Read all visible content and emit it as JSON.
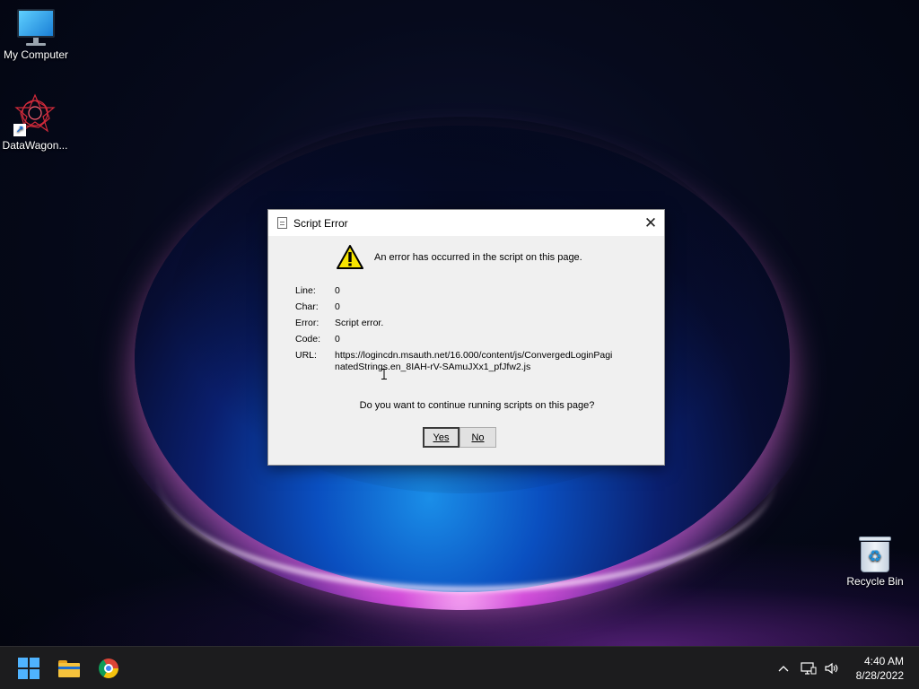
{
  "desktop": {
    "icons": [
      {
        "label": "My Computer",
        "icon": "monitor-icon"
      },
      {
        "label": "DataWagon...",
        "icon": "datawagon-star-icon"
      },
      {
        "label": "Recycle Bin",
        "icon": "recycle-bin-icon"
      }
    ]
  },
  "dialog": {
    "title": "Script Error",
    "close_symbol": "✕",
    "message": "An error has occurred in the script on this page.",
    "fields": [
      {
        "key": "Line:",
        "value": "0"
      },
      {
        "key": "Char:",
        "value": "0"
      },
      {
        "key": "Error:",
        "value": "Script error."
      },
      {
        "key": "Code:",
        "value": "0"
      },
      {
        "key": "URL:",
        "value": "https://logincdn.msauth.net/16.000/content/js/ConvergedLoginPaginatedStrings.en_8IAH-rV-SAmuJXx1_pfJfw2.js"
      }
    ],
    "question": "Do you want to continue running scripts on this page?",
    "buttons": {
      "yes": "Yes",
      "no": "No"
    }
  },
  "taskbar": {
    "apps": [
      {
        "name": "Start",
        "icon": "windows-logo-icon"
      },
      {
        "name": "File Explorer",
        "icon": "folder-icon"
      },
      {
        "name": "Google Chrome",
        "icon": "chrome-icon"
      }
    ],
    "tray": {
      "chevron": "^",
      "network_icon": "network-icon",
      "volume_icon": "volume-icon"
    },
    "clock": {
      "time": "4:40 AM",
      "date": "8/28/2022"
    }
  },
  "colors": {
    "taskbar_bg": "#1c1c1e",
    "dialog_bg": "#f0f0f0",
    "accent": "#4fb3ff",
    "warning_yellow": "#f7e500"
  }
}
